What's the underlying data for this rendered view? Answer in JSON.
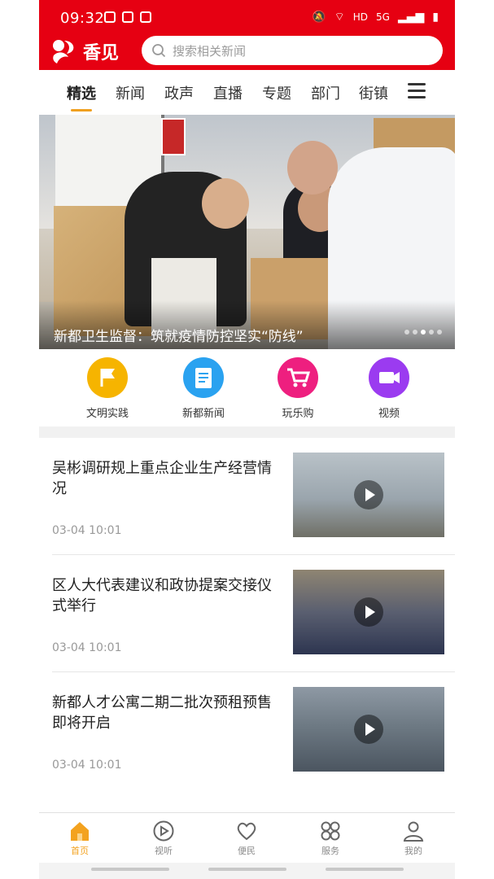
{
  "status_bar": {
    "time": "09:32",
    "network_label": "HD",
    "signal_label": "5G"
  },
  "header": {
    "app_name": "香见",
    "search_placeholder": "搜索相关新闻"
  },
  "tabs": [
    {
      "label": "精选",
      "active": true
    },
    {
      "label": "新闻"
    },
    {
      "label": "政声"
    },
    {
      "label": "直播"
    },
    {
      "label": "专题"
    },
    {
      "label": "部门"
    },
    {
      "label": "街镇"
    }
  ],
  "banner": {
    "title": "新都卫生监督：筑就疫情防控坚实“防线”",
    "slide_index": 3,
    "slide_count": 5
  },
  "quick_entries": [
    {
      "label": "文明实践",
      "icon": "flag-icon",
      "color": "#f6b400"
    },
    {
      "label": "新都新闻",
      "icon": "document-icon",
      "color": "#2aa2f0"
    },
    {
      "label": "玩乐购",
      "icon": "cart-icon",
      "color": "#ee1f7f"
    },
    {
      "label": "视频",
      "icon": "video-camera-icon",
      "color": "#9b3bf0"
    }
  ],
  "news": [
    {
      "title": "吴彬调研规上重点企业生产经营情况",
      "time": "03-04 10:01"
    },
    {
      "title": "区人大代表建议和政协提案交接仪式举行",
      "time": "03-04 10:01"
    },
    {
      "title": "新都人才公寓二期二批次预租预售即将开启",
      "time": "03-04 10:01"
    }
  ],
  "bottom_nav": [
    {
      "label": "首页",
      "icon": "home-icon",
      "active": true
    },
    {
      "label": "视听",
      "icon": "play-circle-icon"
    },
    {
      "label": "便民",
      "icon": "heart-icon"
    },
    {
      "label": "服务",
      "icon": "grid-icon"
    },
    {
      "label": "我的",
      "icon": "user-icon"
    }
  ],
  "colors": {
    "brand_red": "#e60012",
    "accent_orange": "#f3a21f"
  }
}
